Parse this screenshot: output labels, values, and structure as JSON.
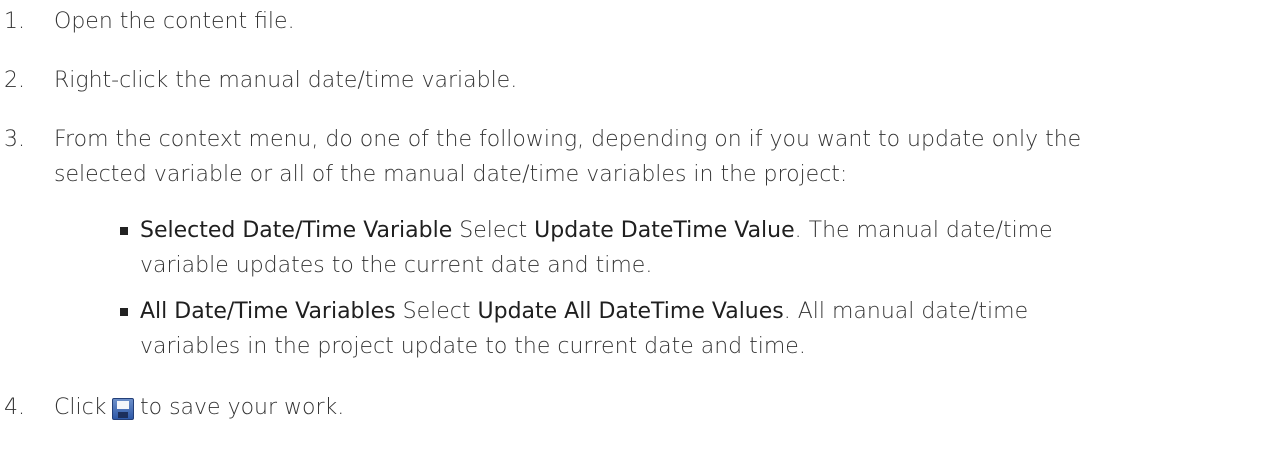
{
  "steps": [
    {
      "number": "1.",
      "text": "Open the content file."
    },
    {
      "number": "2.",
      "text": "Right-click the manual date/time variable."
    },
    {
      "number": "3.",
      "text_line1": "From the context menu, do one of the following, depending on if you want to update only the",
      "text_line2": "selected variable or all of the manual date/time variables in the project:",
      "options": [
        {
          "term": "Selected Date/Time Variable",
          "select_word": "Select",
          "command": "Update DateTime Value",
          "desc_line1_end": ". The manual date/time",
          "desc_line2": "variable updates to the current date and time."
        },
        {
          "term": "All Date/Time Variables",
          "select_word": "Select",
          "command": "Update All DateTime Values",
          "desc_line1_end": ". All manual date/time",
          "desc_line2": "variables in the project update to the current date and time."
        }
      ]
    },
    {
      "number": "4.",
      "text_before": "Click",
      "icon": "save-icon",
      "text_after": "to save your work."
    }
  ]
}
